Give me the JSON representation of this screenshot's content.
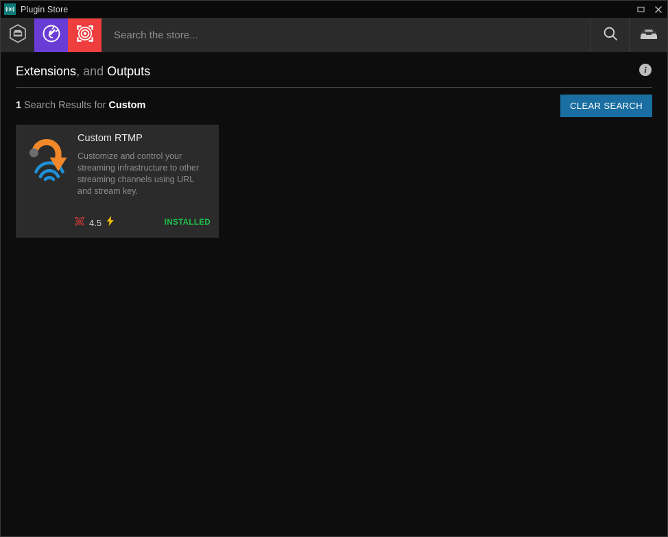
{
  "window": {
    "title": "Plugin Store",
    "app_icon": "signal-wave-icon",
    "controls": [
      {
        "name": "maximize-button",
        "icon": "maximize-icon"
      },
      {
        "name": "close-button",
        "icon": "close-icon"
      }
    ]
  },
  "toolbar": {
    "tabs": [
      {
        "name": "tab-store",
        "icon": "store-hexagon-icon",
        "color": "#2b2b2b",
        "active": false
      },
      {
        "name": "tab-plugins",
        "icon": "plug-circle-icon",
        "color": "#6a3cd6",
        "active": true
      },
      {
        "name": "tab-outputs",
        "icon": "target-output-icon",
        "color": "#ef3e3e",
        "active": true
      }
    ],
    "search": {
      "value": "",
      "placeholder": "Search the store..."
    },
    "actions": [
      {
        "name": "search-button",
        "icon": "search-icon"
      },
      {
        "name": "inbox-button",
        "icon": "inbox-tray-icon"
      }
    ]
  },
  "section": {
    "title_primary": "Extensions",
    "title_middle": ", and ",
    "title_secondary": "Outputs",
    "info_icon": "info-icon"
  },
  "results": {
    "count": "1",
    "label": "Search Results for",
    "term": "Custom",
    "clear_label": "CLEAR SEARCH",
    "clear_color": "#1a6ea2"
  },
  "cards": [
    {
      "name": "plugin-card-custom-rtmp",
      "icon": "rtmp-arrow-signal-icon",
      "title": "Custom RTMP",
      "description": "Customize and control your streaming infrastructure to other streaming channels using URL and stream key.",
      "badge_icon": "target-output-icon",
      "rating": "4.5",
      "bolt_icon": "lightning-bolt-icon",
      "status": "INSTALLED",
      "status_color": "#1fc24a"
    }
  ]
}
